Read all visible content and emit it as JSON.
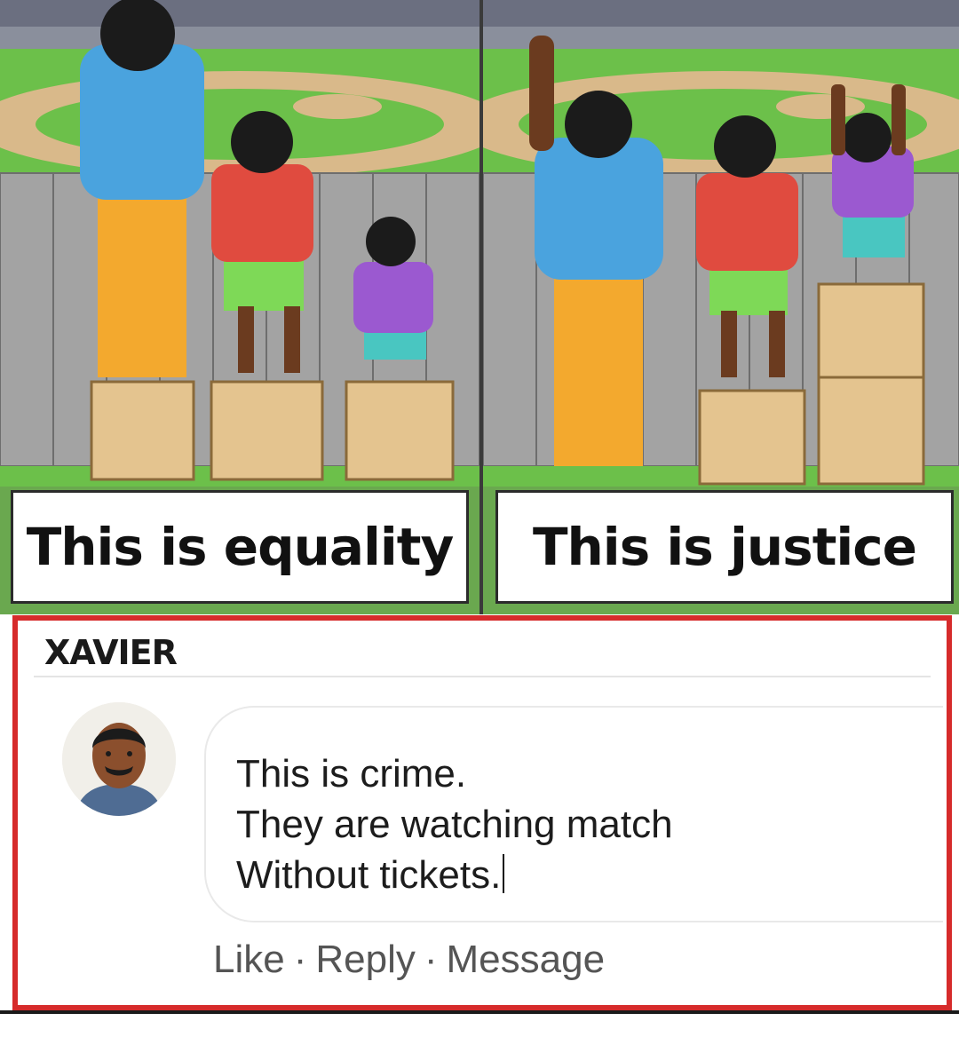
{
  "captions": {
    "left": "This is equality",
    "right": "This is justice"
  },
  "comment": {
    "author": "XAVIER",
    "lines": [
      "This is crime.",
      "They are watching match",
      "Without tickets."
    ],
    "actions": {
      "like": "Like",
      "reply": "Reply",
      "message": "Message",
      "separator": "·"
    }
  },
  "colors": {
    "border_accent": "#d62b2b",
    "grass": "#6aa84f",
    "fence": "#9e9e9e"
  },
  "icons": {
    "avatar": "user-photo"
  }
}
